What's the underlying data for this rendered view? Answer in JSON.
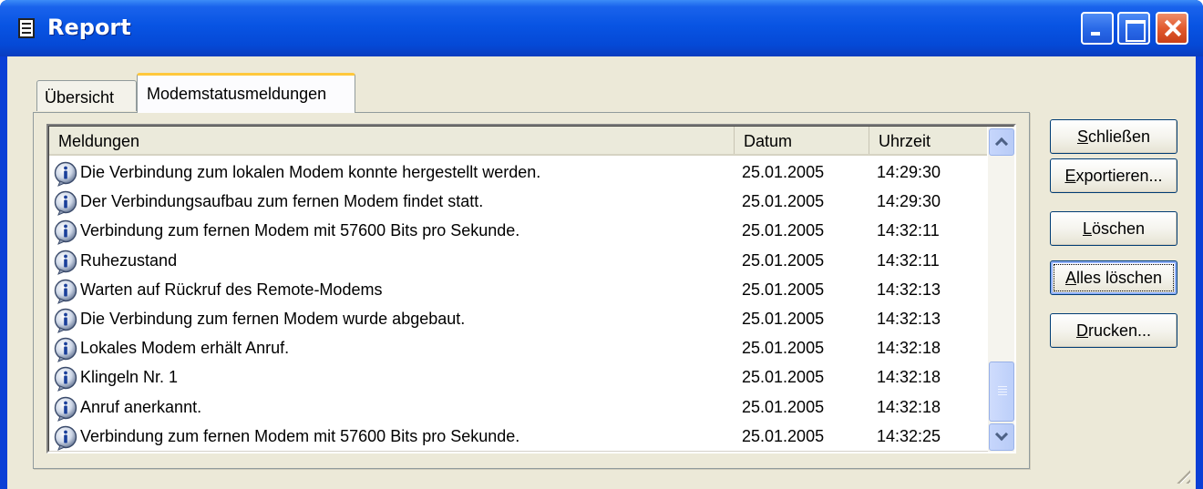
{
  "window": {
    "title": "Report"
  },
  "tabs": [
    {
      "label": "Übersicht",
      "active": false
    },
    {
      "label": "Modemstatusmeldungen",
      "active": true
    }
  ],
  "list": {
    "columns": [
      "Meldungen",
      "Datum",
      "Uhrzeit"
    ],
    "rows": [
      {
        "icon": "info-icon",
        "message": "Die Verbindung zum lokalen Modem konnte hergestellt werden.",
        "date": "25.01.2005",
        "time": "14:29:30"
      },
      {
        "icon": "info-icon",
        "message": "Der Verbindungsaufbau zum fernen Modem findet statt.",
        "date": "25.01.2005",
        "time": "14:29:30"
      },
      {
        "icon": "info-icon",
        "message": "Verbindung zum fernen Modem mit 57600 Bits pro Sekunde.",
        "date": "25.01.2005",
        "time": "14:32:11"
      },
      {
        "icon": "info-icon",
        "message": "Ruhezustand",
        "date": "25.01.2005",
        "time": "14:32:11"
      },
      {
        "icon": "info-icon",
        "message": "Warten auf Rückruf des Remote-Modems",
        "date": "25.01.2005",
        "time": "14:32:13"
      },
      {
        "icon": "info-icon",
        "message": "Die Verbindung zum fernen Modem wurde abgebaut.",
        "date": "25.01.2005",
        "time": "14:32:13"
      },
      {
        "icon": "info-icon",
        "message": "Lokales Modem erhält Anruf.",
        "date": "25.01.2005",
        "time": "14:32:18"
      },
      {
        "icon": "info-icon",
        "message": "Klingeln Nr. 1",
        "date": "25.01.2005",
        "time": "14:32:18"
      },
      {
        "icon": "info-icon",
        "message": "Anruf anerkannt.",
        "date": "25.01.2005",
        "time": "14:32:18"
      },
      {
        "icon": "info-icon",
        "message": "Verbindung zum fernen Modem mit 57600 Bits pro Sekunde.",
        "date": "25.01.2005",
        "time": "14:32:25"
      }
    ]
  },
  "buttons": [
    {
      "label": "Schließen",
      "accel_index": 0
    },
    {
      "label": "Exportieren...",
      "accel_index": 0
    },
    {
      "label": "Löschen",
      "accel_index": 0
    },
    {
      "label": "Alles löschen",
      "accel_index": 0,
      "focused": true
    },
    {
      "label": "Drucken...",
      "accel_index": 0
    }
  ],
  "colors": {
    "titlebar": "#0854e3",
    "window_bg": "#ece9d8",
    "tab_highlight": "#ffc83c",
    "close_button": "#e25a2e"
  }
}
